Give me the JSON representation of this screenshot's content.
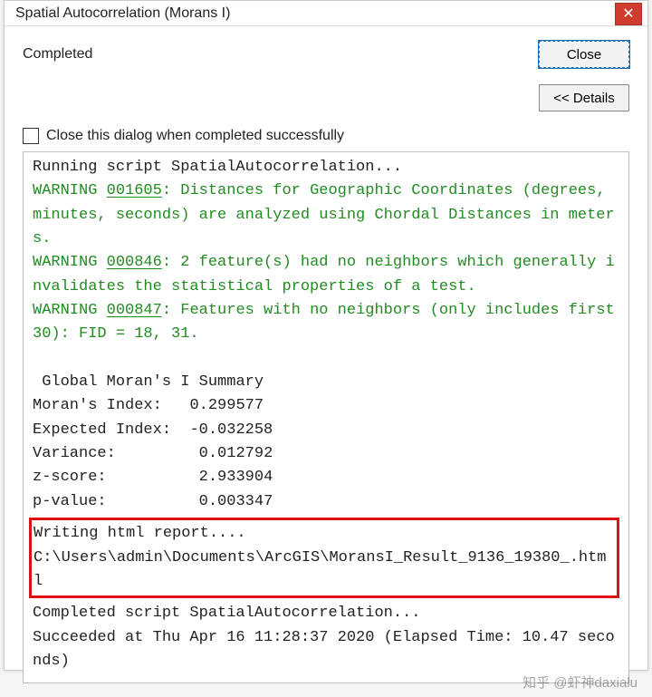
{
  "window": {
    "title": "Spatial Autocorrelation (Morans I)",
    "close_glyph": "✕"
  },
  "status": {
    "text": "Completed",
    "close_button": "Close",
    "details_button": "<< Details"
  },
  "checkbox": {
    "label": "Close this dialog when completed successfully",
    "checked": false
  },
  "output": {
    "running": "Running script SpatialAutocorrelation...",
    "warn1_prefix": "WARNING ",
    "warn1_code": "001605",
    "warn1_rest": ": Distances for Geographic Coordinates (degrees, minutes, seconds) are analyzed using Chordal Distances in meters.",
    "warn2_prefix": "WARNING ",
    "warn2_code": "000846",
    "warn2_rest": ": 2 feature(s) had no neighbors which generally invalidates the statistical properties of a test.",
    "warn3_prefix": "WARNING ",
    "warn3_code": "000847",
    "warn3_rest": ": Features with no neighbors (only includes first 30): FID = 18, 31.",
    "summary_title": " Global Moran's I Summary",
    "summary": {
      "morans_index_label": "Moran's Index:",
      "morans_index_value": "0.299577",
      "expected_label": "Expected Index:",
      "expected_value": "-0.032258",
      "variance_label": "Variance:",
      "variance_value": "0.012792",
      "zscore_label": "z-score:",
      "zscore_value": "2.933904",
      "pvalue_label": "p-value:",
      "pvalue_value": "0.003347"
    },
    "writing": "Writing html report....",
    "path": "C:\\Users\\admin\\Documents\\ArcGIS\\MoransI_Result_9136_19380_.html",
    "completed": "Completed script SpatialAutocorrelation...",
    "succeeded": "Succeeded at Thu Apr 16 11:28:37 2020 (Elapsed Time: 10.47 seconds)"
  },
  "watermark": "知乎 @虾神daxialu"
}
